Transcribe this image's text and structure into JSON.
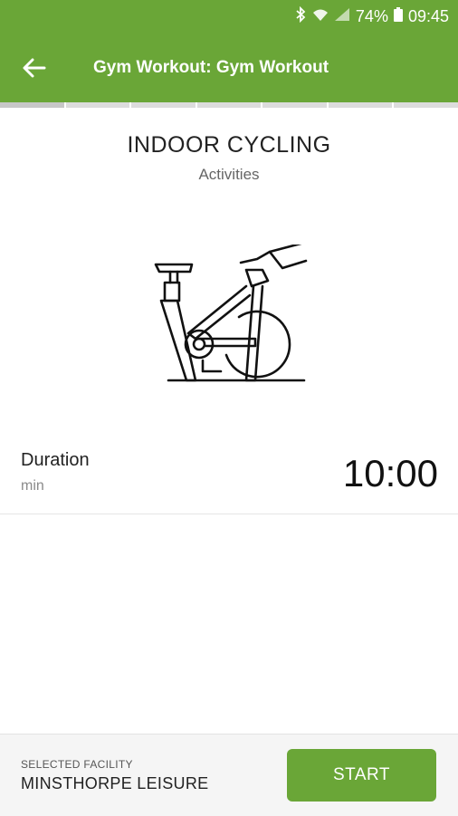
{
  "status_bar": {
    "battery_percent": "74%",
    "time": "09:45",
    "icons": [
      "bluetooth-icon",
      "wifi-icon",
      "signal-icon",
      "battery-icon"
    ]
  },
  "app_bar": {
    "title": "Gym Workout: Gym Workout",
    "back_icon": "arrow-left-icon",
    "color": "#6aa637"
  },
  "activity": {
    "title": "INDOOR CYCLING",
    "subtitle": "Activities",
    "icon": "spin-bike-icon"
  },
  "duration": {
    "label": "Duration",
    "unit": "min",
    "value": "10:00"
  },
  "footer": {
    "facility_caption": "SELECTED FACILITY",
    "facility_name": "MINSTHORPE LEISURE",
    "start_label": "START"
  }
}
